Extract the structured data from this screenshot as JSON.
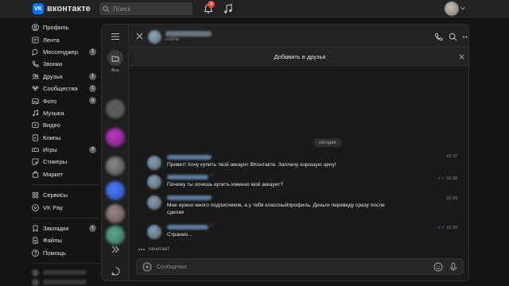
{
  "topbar": {
    "logo_mark": "VK",
    "logo_text": "вконтакте",
    "search_placeholder": "Поиск",
    "notifications_count": "4"
  },
  "nav": {
    "items": [
      {
        "label": "Профиль",
        "icon": "user-circle-icon",
        "badge": ""
      },
      {
        "label": "Лента",
        "icon": "news-icon",
        "badge": ""
      },
      {
        "label": "Мессенджер",
        "icon": "message-icon",
        "badge": "1"
      },
      {
        "label": "Звонки",
        "icon": "phone-icon",
        "badge": ""
      },
      {
        "label": "Друзья",
        "icon": "friends-icon",
        "badge": "1"
      },
      {
        "label": "Сообщества",
        "icon": "groups-icon",
        "badge": "1"
      },
      {
        "label": "Фото",
        "icon": "photo-icon",
        "badge": "9"
      },
      {
        "label": "Музыка",
        "icon": "music-icon",
        "badge": ""
      },
      {
        "label": "Видео",
        "icon": "video-icon",
        "badge": ""
      },
      {
        "label": "Клипы",
        "icon": "clips-icon",
        "badge": ""
      },
      {
        "label": "Игры",
        "icon": "gamepad-icon",
        "badge": "3"
      },
      {
        "label": "Стикеры",
        "icon": "sticker-icon",
        "badge": ""
      },
      {
        "label": "Маркет",
        "icon": "bag-icon",
        "badge": ""
      }
    ],
    "items2": [
      {
        "label": "Сервисы",
        "icon": "services-icon",
        "badge": ""
      },
      {
        "label": "VK Pay",
        "icon": "vkpay-icon",
        "badge": ""
      }
    ],
    "items3": [
      {
        "label": "Закладки",
        "icon": "bookmark-icon",
        "badge": "1"
      },
      {
        "label": "Файлы",
        "icon": "file-icon",
        "badge": ""
      },
      {
        "label": "Помощь",
        "icon": "help-icon",
        "badge": ""
      }
    ]
  },
  "folders": {
    "all_label": "Все"
  },
  "chat": {
    "status": "online",
    "add_friend_label": "Добавить в друзья",
    "date_divider": "сегодня",
    "messages": [
      {
        "text": "Привет! Хочу купить твой аккаунт ВКонтакте. Заплачу хорошую цену!",
        "time": "16:37",
        "read": false
      },
      {
        "text": "Почему ты хочешь купить именно мой аккаунт?",
        "time": "16:39",
        "read": true
      },
      {
        "text": "Мне нужно много подписчиков, а у тебя классныйпрофиль. Деньги переведу сразу после сделки",
        "time": "16:39",
        "read": false
      },
      {
        "text": "Странно...",
        "time": "16:39",
        "read": true
      }
    ],
    "typing_label": "печатает",
    "composer_placeholder": "Сообщение",
    "read_mark": "✓✓"
  },
  "colors": {
    "accent": "#0077ff",
    "badge_red": "#e64646",
    "background": "#141414",
    "panel": "#222222"
  }
}
